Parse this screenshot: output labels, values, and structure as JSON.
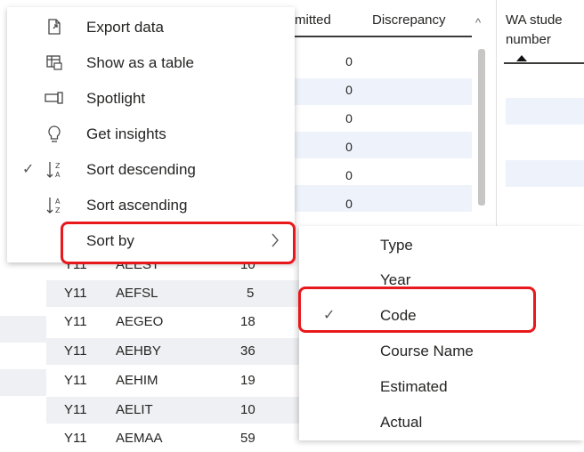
{
  "context_menu": {
    "items": [
      {
        "label": "Export data",
        "icon": "export-icon",
        "checked": false
      },
      {
        "label": "Show as a table",
        "icon": "table-icon",
        "checked": false
      },
      {
        "label": "Spotlight",
        "icon": "spotlight-icon",
        "checked": false
      },
      {
        "label": "Get insights",
        "icon": "lightbulb-icon",
        "checked": false
      },
      {
        "label": "Sort descending",
        "icon": "sort-descending-icon",
        "checked": true
      },
      {
        "label": "Sort ascending",
        "icon": "sort-ascending-icon",
        "checked": false
      },
      {
        "label": "Sort by",
        "icon": "",
        "checked": false,
        "has_submenu": true,
        "highlighted": true
      }
    ],
    "glyphs": {
      "check": "✓",
      "chevron": "›",
      "lightbulb": "💡"
    }
  },
  "sort_by_submenu": {
    "items": [
      {
        "label": "Type",
        "checked": false
      },
      {
        "label": "Year",
        "checked": false
      },
      {
        "label": "Code",
        "checked": true,
        "highlighted": true
      },
      {
        "label": "Course Name",
        "checked": false
      },
      {
        "label": "Estimated",
        "checked": false
      },
      {
        "label": "Actual",
        "checked": false
      }
    ]
  },
  "table": {
    "headers": {
      "partial_left": "mitted",
      "discrepancy": "Discrepancy"
    },
    "discrepancy_values": [
      "0",
      "0",
      "0",
      "0",
      "0",
      "0"
    ],
    "rows": [
      {
        "year": "Y11",
        "code": "AEEST",
        "value": "10"
      },
      {
        "year": "Y11",
        "code": "AEFSL",
        "value": "5"
      },
      {
        "year": "Y11",
        "code": "AEGEO",
        "value": "18"
      },
      {
        "year": "Y11",
        "code": "AEHBY",
        "value": "36"
      },
      {
        "year": "Y11",
        "code": "AEHIM",
        "value": "19"
      },
      {
        "year": "Y11",
        "code": "AELIT",
        "value": "10"
      },
      {
        "year": "Y11",
        "code": "AEMAA",
        "value": "59"
      }
    ],
    "scroll_up_glyph": "^"
  },
  "right_panel": {
    "title_line1": "WA stude",
    "title_line2": "number"
  },
  "colors": {
    "highlight": "#e8191c",
    "band": "#eef3fb"
  }
}
